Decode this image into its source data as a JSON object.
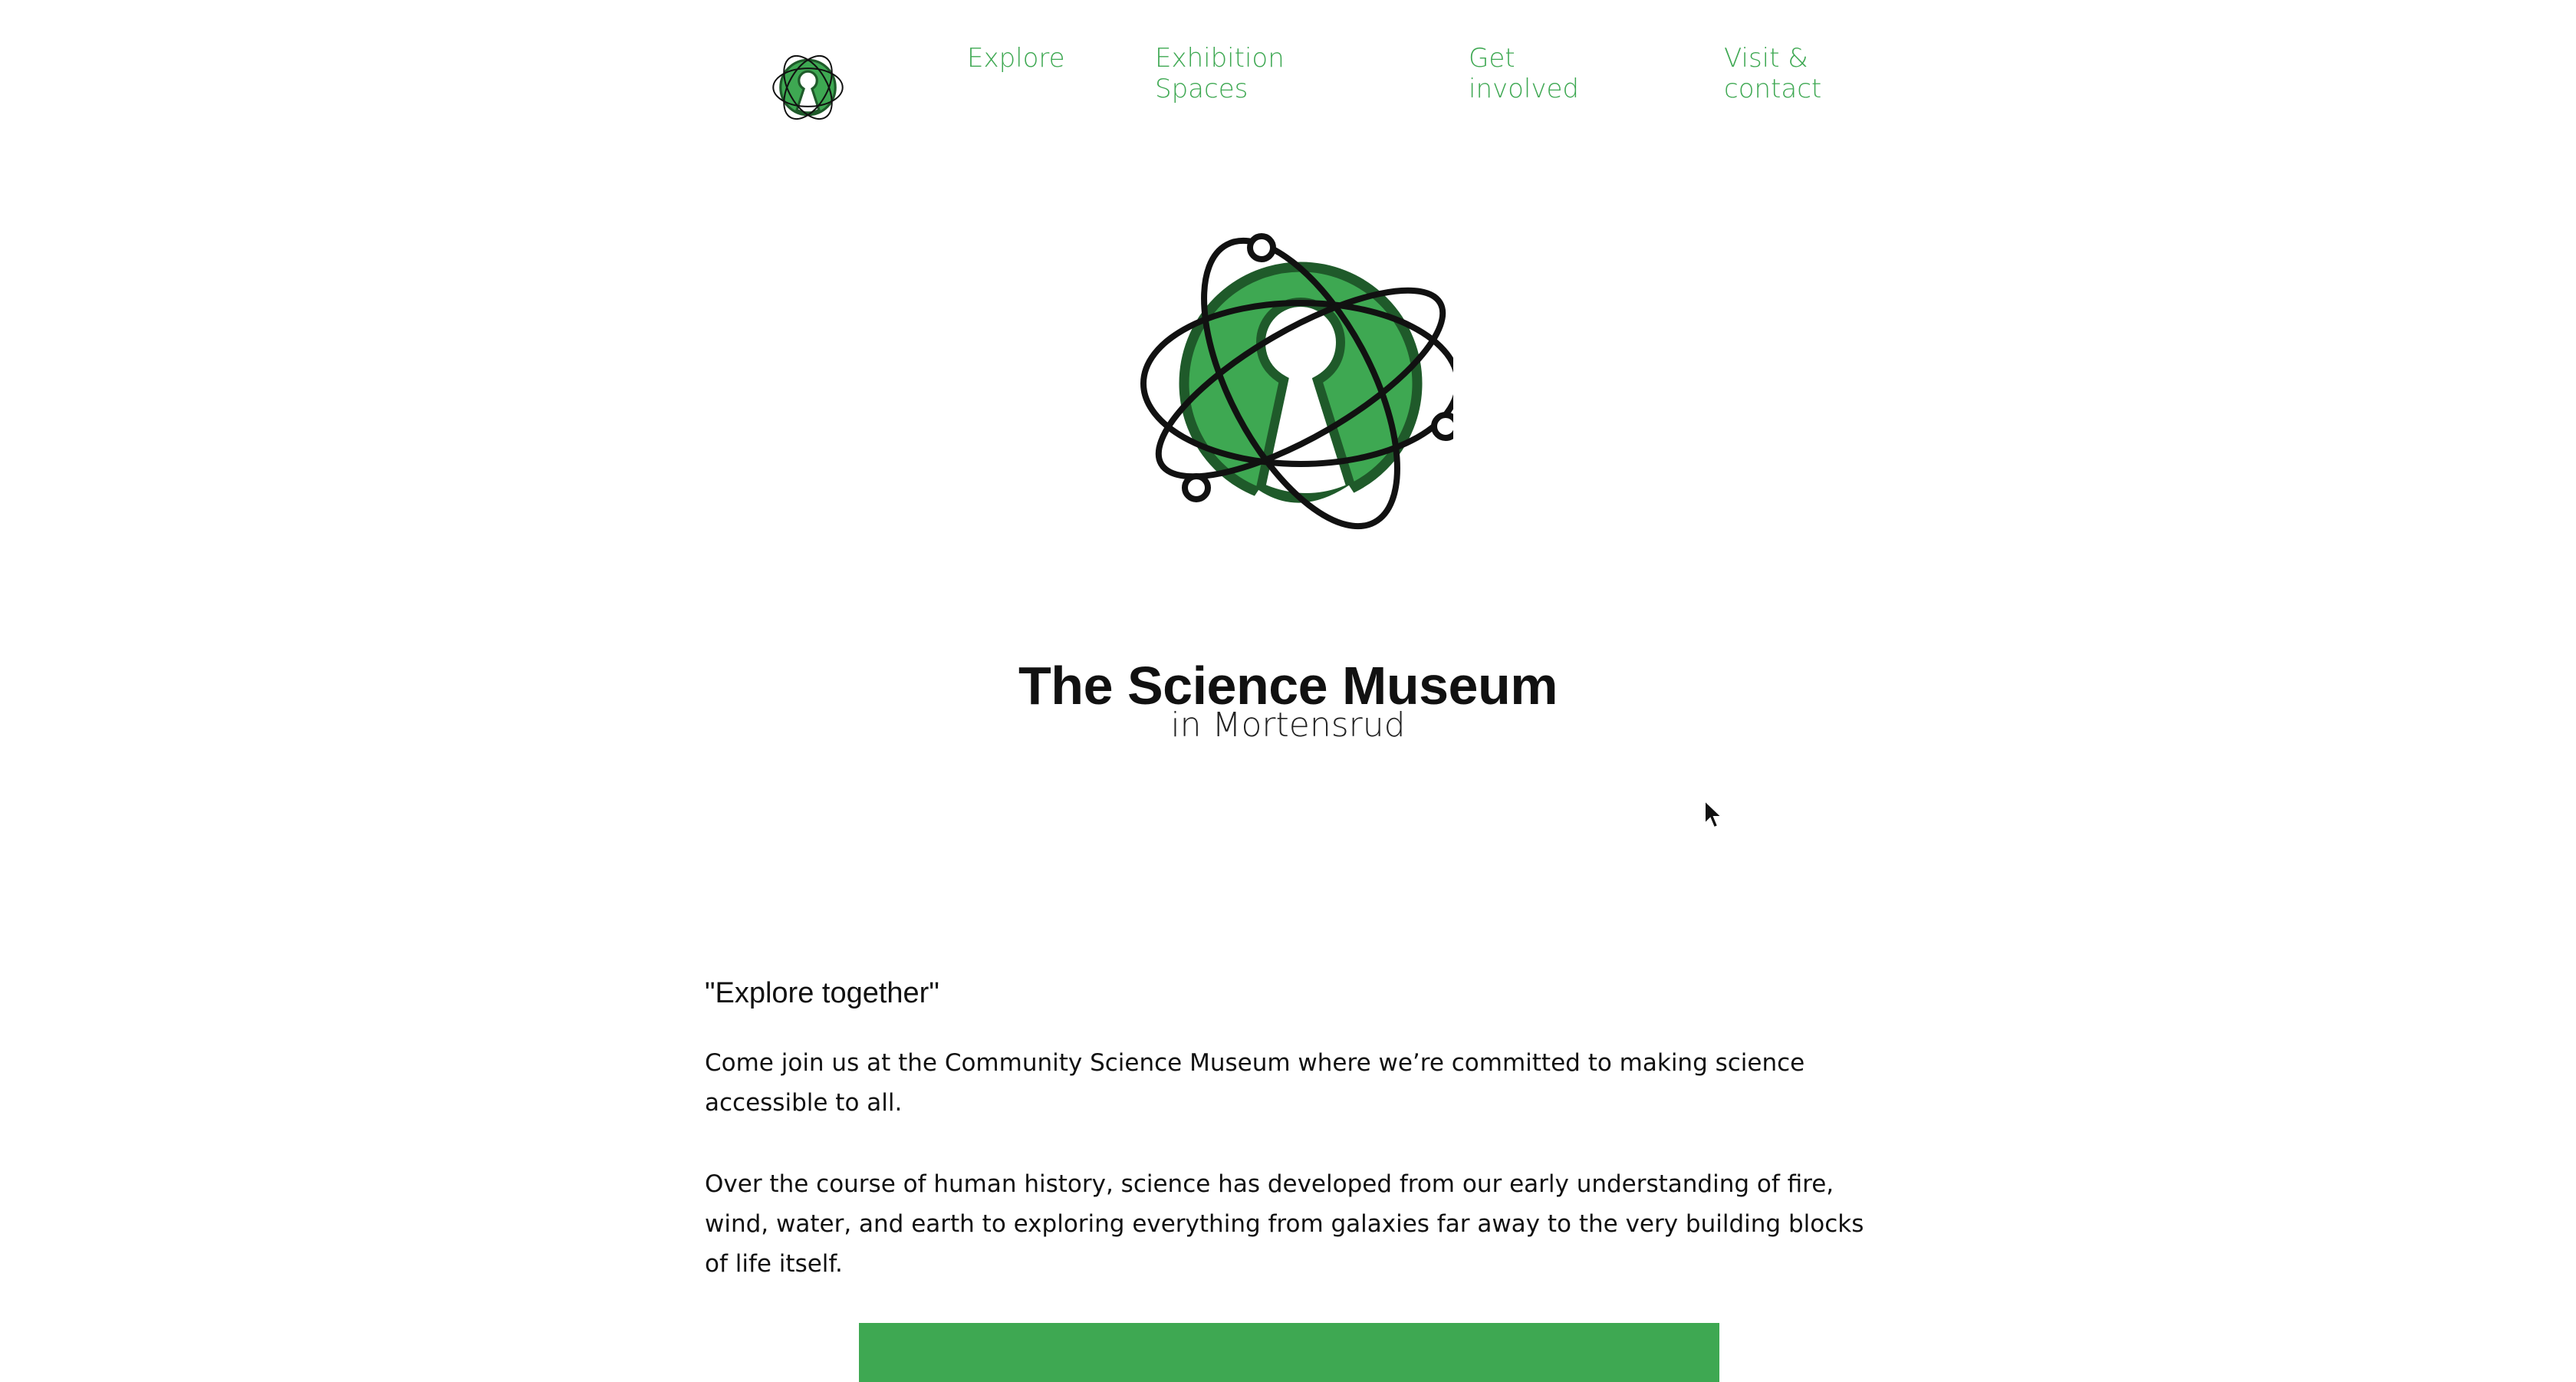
{
  "brand": {
    "accent_color": "#3ea852",
    "dark_green": "#1f5a2a",
    "logo_icon": "atom-keyhole-logo-icon"
  },
  "nav": {
    "items": [
      {
        "label": "Explore"
      },
      {
        "label": "Exhibition\nSpaces"
      },
      {
        "label": "Get\ninvolved"
      },
      {
        "label": "Visit &\ncontact"
      }
    ]
  },
  "hero": {
    "title": "The Science Museum",
    "subtitle": "in Mortensrud"
  },
  "content": {
    "tagline": "\"Explore together\"",
    "paragraphs": [
      "Come join us at the Community Science Museum where we’re committed to making science accessible to all.",
      "Over the course of human history, science has developed from our early understanding of fire, wind, water, and earth to exploring everything from galaxies far away to the very building blocks of life itself."
    ]
  }
}
